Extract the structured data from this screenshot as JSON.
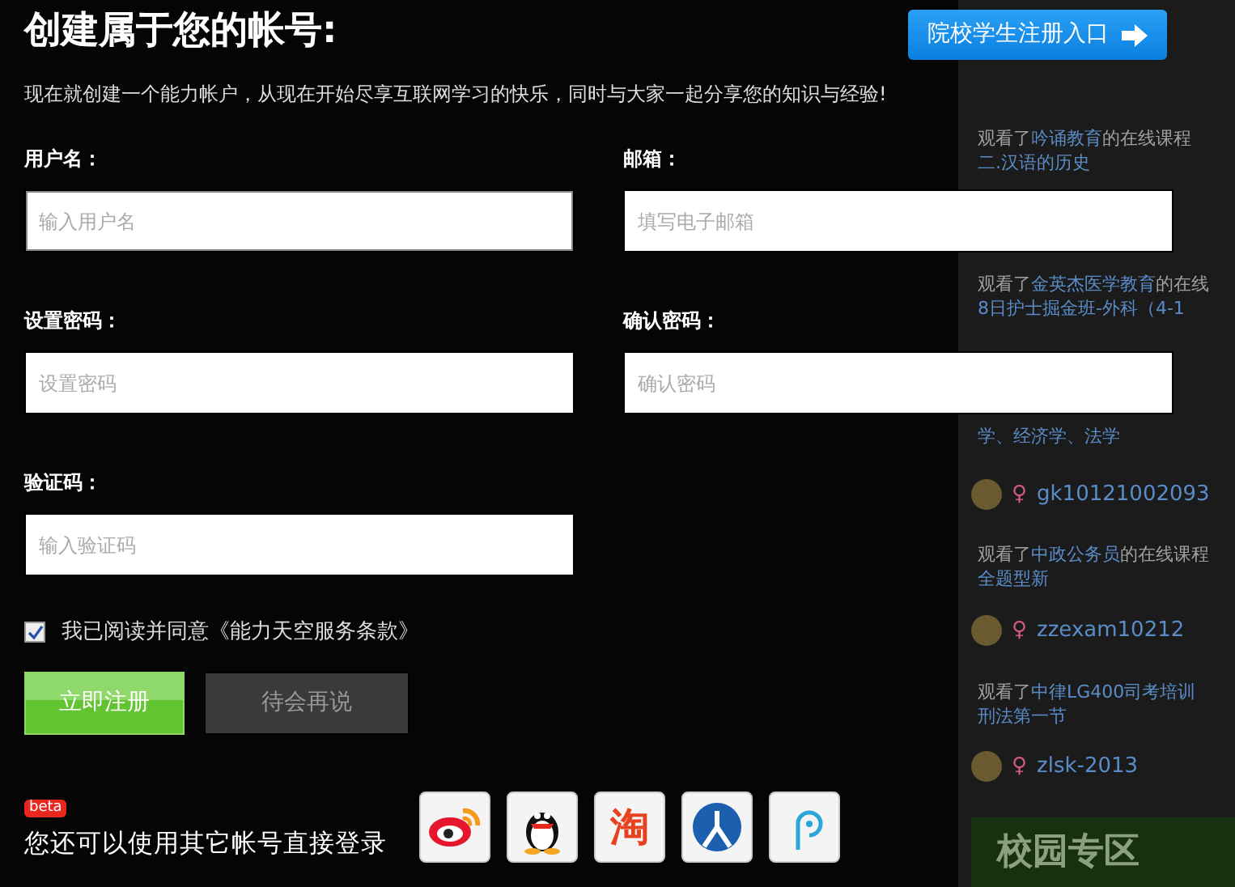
{
  "feed": [
    {
      "kind": "activity",
      "prefix": "观看了",
      "org": "吟诵教育",
      "suffix": "的在线课程",
      "course": "二.汉语的历史"
    },
    {
      "kind": "activity",
      "prefix": "观看了",
      "org": "金英杰医学教育",
      "suffix": "的在线",
      "course": "8日护士掘金班-外科（4-1"
    },
    {
      "kind": "course_only",
      "course": "学、经济学、法学"
    },
    {
      "kind": "user",
      "gender": "♀",
      "name": "gk10121002093"
    },
    {
      "kind": "activity",
      "prefix": "观看了",
      "org": "中政公务员",
      "suffix": "的在线课程",
      "course": "全题型新"
    },
    {
      "kind": "user",
      "gender": "♀",
      "name": "zzexam10212"
    },
    {
      "kind": "activity",
      "prefix": "观看了",
      "org": "中律LG400司考培训",
      "course": "刑法第一节"
    },
    {
      "kind": "user",
      "gender": "♀",
      "name": "zlsk-2013"
    }
  ],
  "campus_zone": "校园专区",
  "dialog": {
    "title": "创建属于您的帐号:",
    "subtitle": "现在就创建一个能力帐户，从现在开始尽享互联网学习的快乐，同时与大家一起分享您的知识与经验!",
    "school_button": "院校学生注册入口",
    "fields": [
      {
        "label": "用户名：",
        "placeholder": "输入用户名",
        "focused": true
      },
      {
        "label": "邮箱：",
        "placeholder": "填写电子邮箱",
        "focused": false
      },
      {
        "label": "设置密码：",
        "placeholder": "设置密码",
        "focused": false
      },
      {
        "label": "确认密码：",
        "placeholder": "确认密码",
        "focused": false
      },
      {
        "label": "验证码：",
        "placeholder": "输入验证码",
        "focused": false
      }
    ],
    "agree": {
      "checked": true,
      "text": "我已阅读并同意",
      "link": "《能力天空服务条款》"
    },
    "buttons": [
      {
        "kind": "primary",
        "label": "立即注册"
      },
      {
        "kind": "secondary",
        "label": "待会再说"
      }
    ],
    "badge": "beta",
    "alt_login_text": "您还可以使用其它帐号直接登录",
    "alt_logins": [
      {
        "kind": "weibo"
      },
      {
        "kind": "qq"
      },
      {
        "kind": "taobao",
        "glyph": "淘"
      },
      {
        "kind": "renren"
      },
      {
        "kind": "pen"
      }
    ]
  }
}
